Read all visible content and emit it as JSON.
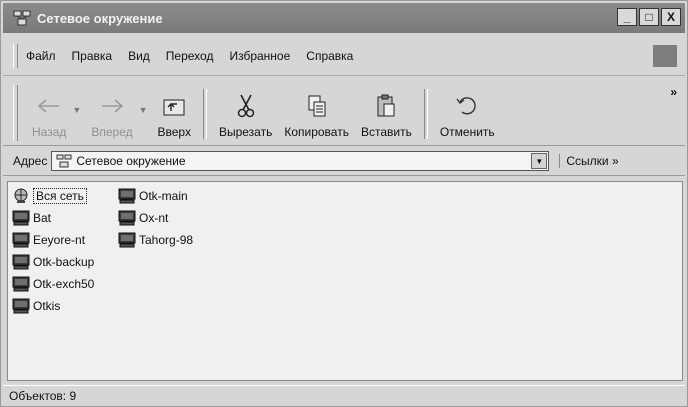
{
  "window": {
    "title": "Сетевое окружение",
    "title_icon": "network-neighborhood-icon",
    "controls": {
      "minimize": "_",
      "maximize": "□",
      "close": "X"
    }
  },
  "menu": {
    "items": [
      {
        "label": "Файл"
      },
      {
        "label": "Правка"
      },
      {
        "label": "Вид"
      },
      {
        "label": "Переход"
      },
      {
        "label": "Избранное"
      },
      {
        "label": "Справка"
      }
    ]
  },
  "toolbar": {
    "back": "Назад",
    "forward": "Вперед",
    "up": "Вверх",
    "cut": "Вырезать",
    "copy": "Копировать",
    "paste": "Вставить",
    "undo": "Отменить",
    "more": "»"
  },
  "address": {
    "label": "Адрес",
    "value": "Сетевое окружение",
    "links": "Ссылки »"
  },
  "items": [
    {
      "label": "Вся сеть",
      "icon": "globe-icon"
    },
    {
      "label": "Otk-main",
      "icon": "computer-icon"
    },
    {
      "label": "Bat",
      "icon": "computer-icon"
    },
    {
      "label": "Ox-nt",
      "icon": "computer-icon"
    },
    {
      "label": "Eeyore-nt",
      "icon": "computer-icon"
    },
    {
      "label": "Tahorg-98",
      "icon": "computer-icon"
    },
    {
      "label": "Otk-backup",
      "icon": "computer-icon"
    },
    {
      "label": "Otk-exch50",
      "icon": "computer-icon"
    },
    {
      "label": "Otkis",
      "icon": "computer-icon"
    }
  ],
  "status": {
    "text": "Объектов: 9"
  }
}
